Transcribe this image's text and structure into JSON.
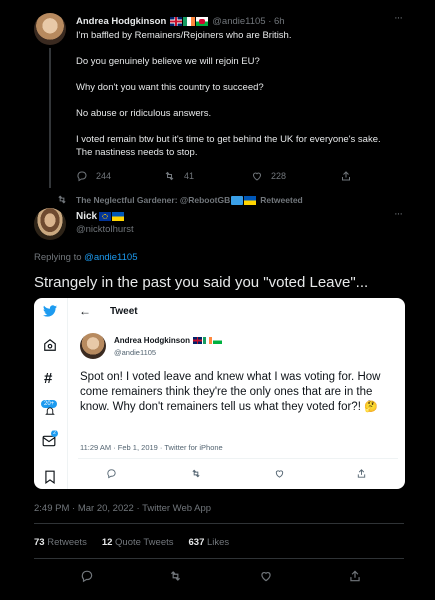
{
  "first_tweet": {
    "name": "Andrea Hodgkinson",
    "handle_time": "@andie1105 · 6h",
    "more": "···",
    "lines": [
      "I'm baffled by Remainers/Rejoiners who are British.",
      "Do you genuinely believe we will rejoin EU?",
      "Why don't you want this country to succeed?",
      "No abuse or ridiculous answers.",
      "I voted remain btw but it's time to get behind the UK for everyone's sake.",
      "The nastiness needs to stop."
    ],
    "replies": "244",
    "retweets": "41",
    "likes": "228"
  },
  "retweet_notice": {
    "text": "The Neglectful Gardener: @RebootGB",
    "suffix": "Retweeted"
  },
  "main_tweet": {
    "name": "Nick",
    "handle": "@nicktolhurst",
    "more": "···",
    "replying_prefix": "Replying to ",
    "replying_handle": "@andie1105",
    "body": "Strangely in the past you said you \"voted Leave\"...",
    "timestamp": "2:49 PM · Mar 20, 2022 · Twitter Web App",
    "stats": {
      "retweets_count": "73",
      "retweets_label": " Retweets",
      "quotes_count": "12",
      "quotes_label": " Quote Tweets",
      "likes_count": "637",
      "likes_label": " Likes"
    }
  },
  "screenshot": {
    "header_title": "Tweet",
    "badge": "20+",
    "msg_badge": "2",
    "name": "Andrea Hodgkinson",
    "handle": "@andie1105",
    "body": "Spot on! I voted leave and knew what I was voting for. How come remainers think they're the only ones that are in the know. Why don't remainers tell us what they voted for?!",
    "emoji": "🤔",
    "meta": "11:29 AM · Feb 1, 2019 · Twitter for iPhone"
  },
  "colors": {
    "accent": "#1d9bf0",
    "background": "#000000",
    "muted": "#71767b"
  }
}
